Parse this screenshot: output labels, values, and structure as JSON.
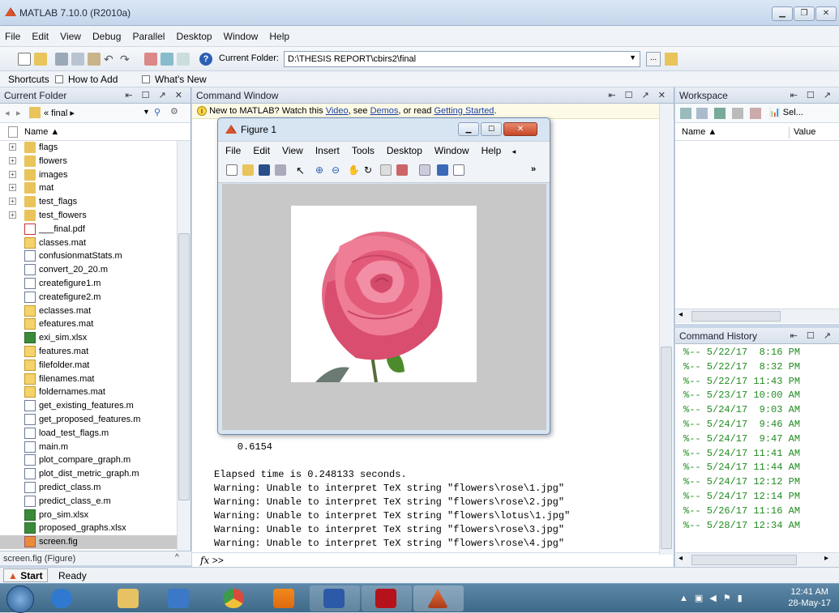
{
  "app": {
    "title": "MATLAB 7.10.0 (R2010a)"
  },
  "menu": [
    "File",
    "Edit",
    "View",
    "Debug",
    "Parallel",
    "Desktop",
    "Window",
    "Help"
  ],
  "toolbar": {
    "current_folder_label": "Current Folder:",
    "current_folder_path": "D:\\THESIS REPORT\\cbirs2\\final"
  },
  "shortcuts": {
    "label": "Shortcuts",
    "items": [
      "How to Add",
      "What's New"
    ]
  },
  "current_folder": {
    "title": "Current Folder",
    "nav_path": "« final ▸",
    "column_name": "Name ▲",
    "items": [
      {
        "name": "flags",
        "type": "folder",
        "expand": "+"
      },
      {
        "name": "flowers",
        "type": "folder",
        "expand": "+"
      },
      {
        "name": "images",
        "type": "folder",
        "expand": "+"
      },
      {
        "name": "mat",
        "type": "folder",
        "expand": "+"
      },
      {
        "name": "test_flags",
        "type": "folder",
        "expand": "+"
      },
      {
        "name": "test_flowers",
        "type": "folder",
        "expand": "+"
      },
      {
        "name": "___final.pdf",
        "type": "pdf"
      },
      {
        "name": "classes.mat",
        "type": "mat"
      },
      {
        "name": "confusionmatStats.m",
        "type": "m"
      },
      {
        "name": "convert_20_20.m",
        "type": "m"
      },
      {
        "name": "createfigure1.m",
        "type": "m"
      },
      {
        "name": "createfigure2.m",
        "type": "m"
      },
      {
        "name": "eclasses.mat",
        "type": "mat"
      },
      {
        "name": "efeatures.mat",
        "type": "mat"
      },
      {
        "name": "exi_sim.xlsx",
        "type": "xls"
      },
      {
        "name": "features.mat",
        "type": "mat"
      },
      {
        "name": "filefolder.mat",
        "type": "mat"
      },
      {
        "name": "filenames.mat",
        "type": "mat"
      },
      {
        "name": "foldernames.mat",
        "type": "mat"
      },
      {
        "name": "get_existing_features.m",
        "type": "m"
      },
      {
        "name": "get_proposed_features.m",
        "type": "m"
      },
      {
        "name": "load_test_flags.m",
        "type": "m"
      },
      {
        "name": "main.m",
        "type": "m"
      },
      {
        "name": "plot_compare_graph.m",
        "type": "m"
      },
      {
        "name": "plot_dist_metric_graph.m",
        "type": "m"
      },
      {
        "name": "predict_class.m",
        "type": "m"
      },
      {
        "name": "predict_class_e.m",
        "type": "m"
      },
      {
        "name": "pro_sim.xlsx",
        "type": "xls"
      },
      {
        "name": "proposed_graphs.xlsx",
        "type": "xls"
      },
      {
        "name": "screen.fig",
        "type": "fig",
        "selected": true
      }
    ],
    "status": "screen.fig (Figure)"
  },
  "command_window": {
    "title": "Command Window",
    "info_prefix": "New to MATLAB? Watch this ",
    "info_video": "Video",
    "info_mid1": ", see ",
    "info_demos": "Demos",
    "info_mid2": ", or read ",
    "info_getting_started": "Getting Started",
    "info_suffix": ".",
    "lines": [
      "    0.6154",
      "",
      "Elapsed time is 0.248133 seconds.",
      "Warning: Unable to interpret TeX string \"flowers\\rose\\1.jpg\"",
      "Warning: Unable to interpret TeX string \"flowers\\rose\\2.jpg\"",
      "Warning: Unable to interpret TeX string \"flowers\\lotus\\1.jpg\"",
      "Warning: Unable to interpret TeX string \"flowers\\rose\\3.jpg\"",
      "Warning: Unable to interpret TeX string \"flowers\\rose\\4.jpg\""
    ],
    "prompt_fx": "fx",
    "prompt": ">>"
  },
  "workspace": {
    "title": "Workspace",
    "select_label": "Sel...",
    "col_name": "Name ▲",
    "col_value": "Value"
  },
  "command_history": {
    "title": "Command History",
    "entries": [
      "%-- 5/22/17  8:16 PM",
      "%-- 5/22/17  8:32 PM",
      "%-- 5/22/17 11:43 PM",
      "%-- 5/23/17 10:00 AM",
      "%-- 5/24/17  9:03 AM",
      "%-- 5/24/17  9:46 AM",
      "%-- 5/24/17  9:47 AM",
      "%-- 5/24/17 11:41 AM",
      "%-- 5/24/17 11:44 AM",
      "%-- 5/24/17 12:12 PM",
      "%-- 5/24/17 12:14 PM",
      "%-- 5/26/17 11:16 AM",
      "%-- 5/28/17 12:34 AM"
    ]
  },
  "figure": {
    "title": "Figure 1",
    "menu": [
      "File",
      "Edit",
      "View",
      "Insert",
      "Tools",
      "Desktop",
      "Window",
      "Help"
    ]
  },
  "statusbar": {
    "start": "Start",
    "status": "Ready"
  },
  "taskbar": {
    "time": "12:41 AM",
    "date": "28-May-17"
  },
  "colors": {
    "history_green": "#228b22",
    "link_blue": "#1a3fa8",
    "selection_gray": "#c9c9c9"
  }
}
